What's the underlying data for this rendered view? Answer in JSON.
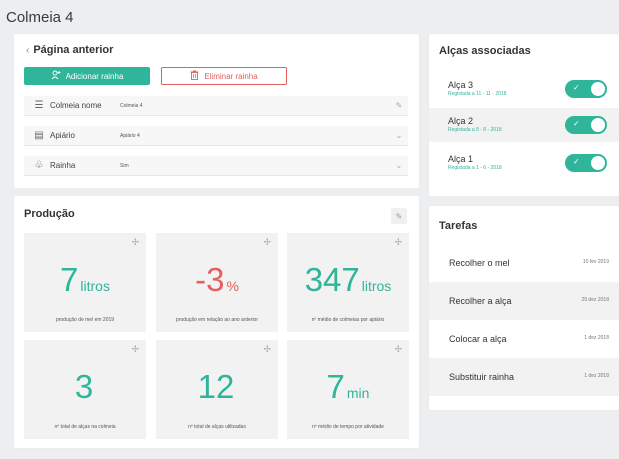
{
  "page": {
    "title": "Colmeia 4"
  },
  "info": {
    "back_label": "Página anterior",
    "add_queen_label": "Adicionar rainha",
    "remove_queen_label": "Eliminar rainha",
    "fields": [
      {
        "label": "Colmeia nome",
        "value": "Colmeia 4",
        "icon": "hive-icon",
        "action": "edit-icon"
      },
      {
        "label": "Apiário",
        "value": "Apiário 4",
        "icon": "apiary-icon",
        "action": "dropdown-icon"
      },
      {
        "label": "Rainha",
        "value": "Sim",
        "icon": "queen-bee-icon",
        "action": "dropdown-icon"
      }
    ]
  },
  "production": {
    "title": "Produção",
    "tiles": [
      {
        "value": "7",
        "unit": "litros",
        "caption": "produção de mel em 2019"
      },
      {
        "value": "-3",
        "unit": "%",
        "caption": "produção em relação ao ano anterior"
      },
      {
        "value": "347",
        "unit": "litros",
        "caption": "nº médio de colmeias por apiário"
      },
      {
        "value": "3",
        "unit": "",
        "caption": "nº total de alças na colmeia"
      },
      {
        "value": "12",
        "unit": "",
        "caption": "nº total de alças utilizadas"
      },
      {
        "value": "7",
        "unit": "min",
        "caption": "nº médio de tempo por atividade"
      }
    ]
  },
  "alcas": {
    "title": "Alças associadas",
    "items": [
      {
        "name": "Alça 3",
        "sub": "Registada a 11 - 11 - 2018",
        "enabled": true
      },
      {
        "name": "Alça 2",
        "sub": "Registada a 8 - 8 - 2018",
        "enabled": true
      },
      {
        "name": "Alça 1",
        "sub": "Registada a 1 - 6 - 2018",
        "enabled": true
      }
    ]
  },
  "tarefas": {
    "title": "Tarefas",
    "items": [
      {
        "name": "Recolher o mel",
        "date": "10 fev 2019"
      },
      {
        "name": "Recolher a alça",
        "date": "29 dez 2018"
      },
      {
        "name": "Colocar a alça",
        "date": "1 dez 2018"
      },
      {
        "name": "Substituir rainha",
        "date": "1 dez 2018"
      }
    ]
  },
  "colors": {
    "accent": "#2fb59a",
    "danger": "#e3605d"
  }
}
